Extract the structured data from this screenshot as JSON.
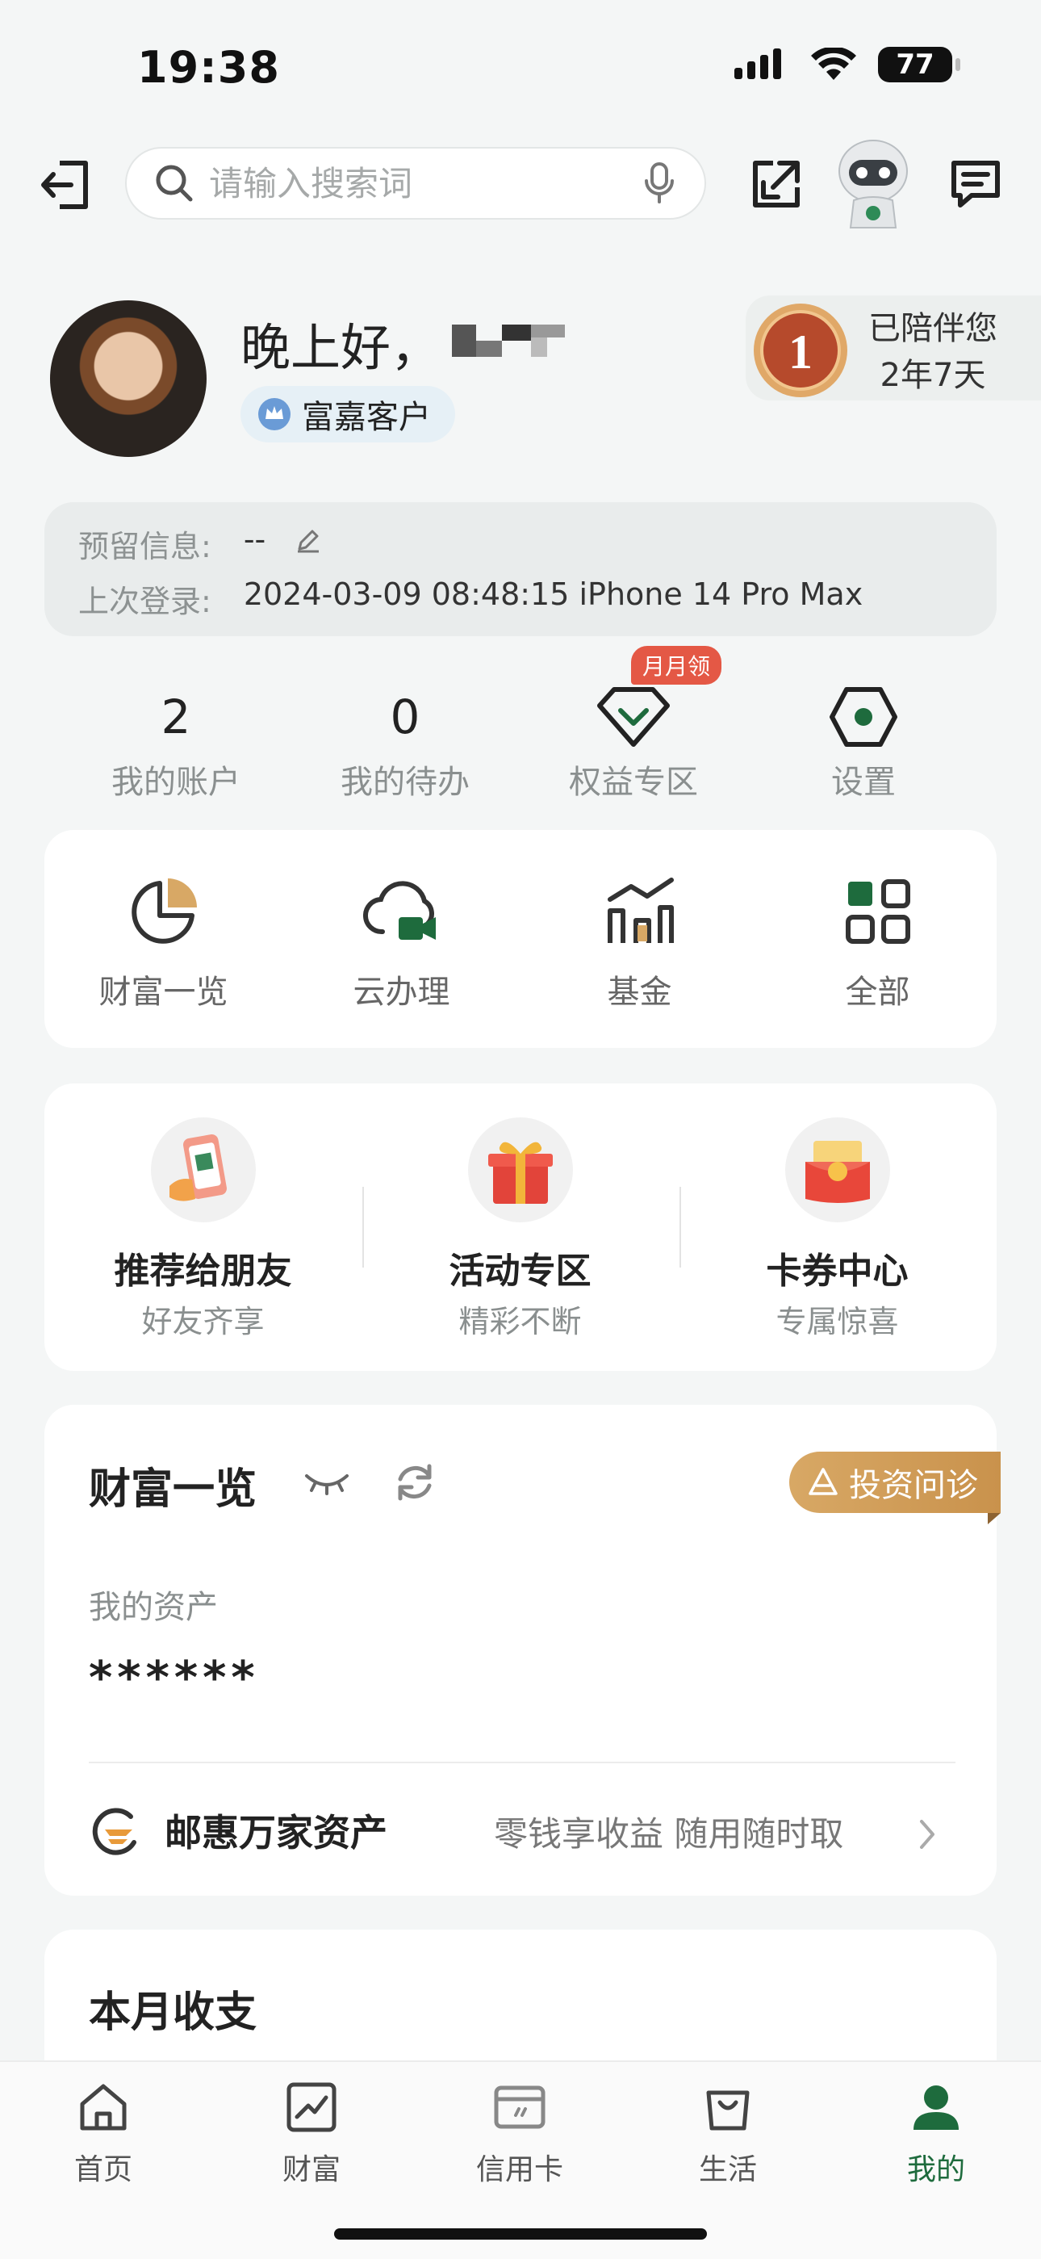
{
  "status_bar": {
    "time": "19:38",
    "battery": "77"
  },
  "top_bar": {
    "search_placeholder": "请输入搜索词"
  },
  "profile": {
    "greeting": "晚上好，",
    "tier": "富嘉客户",
    "companion_line1": "已陪伴您",
    "companion_line2": "2年7天"
  },
  "info": {
    "reserved_label": "预留信息:",
    "reserved_value": "--",
    "last_login_label": "上次登录:",
    "last_login_value": "2024-03-09 08:48:15 iPhone 14 Pro Max"
  },
  "stats": [
    {
      "value": "2",
      "label": "我的账户"
    },
    {
      "value": "0",
      "label": "我的待办"
    },
    {
      "label": "权益专区",
      "tag": "月月领"
    },
    {
      "label": "设置"
    }
  ],
  "quick_actions": [
    "财富一览",
    "云办理",
    "基金",
    "全部"
  ],
  "promos": [
    {
      "title": "推荐给朋友",
      "subtitle": "好友齐享"
    },
    {
      "title": "活动专区",
      "subtitle": "精彩不断"
    },
    {
      "title": "卡券中心",
      "subtitle": "专属惊喜"
    }
  ],
  "wealth": {
    "title": "财富一览",
    "invest_tag": "投资问诊",
    "assets_label": "我的资产",
    "assets_value": "******",
    "product_name": "邮惠万家资产",
    "product_desc": "零钱享收益 随用随时取"
  },
  "monthly": {
    "title": "本月收支"
  },
  "tabs": [
    {
      "label": "首页"
    },
    {
      "label": "财富"
    },
    {
      "label": "信用卡"
    },
    {
      "label": "生活"
    },
    {
      "label": "我的"
    }
  ],
  "colors": {
    "accent": "#1e6b3d",
    "gold": "#c9924c",
    "tag_red": "#e45845"
  }
}
